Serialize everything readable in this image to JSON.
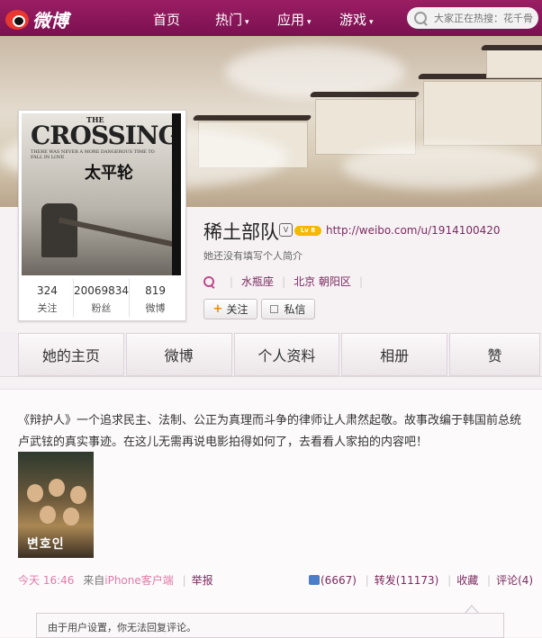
{
  "nav": {
    "brand": "微博",
    "items": [
      {
        "label": "首页",
        "caret": ""
      },
      {
        "label": "热门",
        "caret": "▾"
      },
      {
        "label": "应用",
        "caret": "▾"
      },
      {
        "label": "游戏",
        "caret": "▾"
      }
    ],
    "search_placeholder": "大家正在热搜：花千骨"
  },
  "profile": {
    "poster_title": "CROSSING",
    "poster_the": "THE",
    "poster_tagline": "THERE WAS NEVER A MORE DANGEROUS TIME TO FALL IN LOVE",
    "poster_cn": "太平轮",
    "stats": [
      {
        "value": "324",
        "label": "关注"
      },
      {
        "value": "20069834",
        "label": "粉丝"
      },
      {
        "value": "819",
        "label": "微博"
      }
    ],
    "name": "稀土部队",
    "vip_badge": "V",
    "level_badge": "Lv 8",
    "url": "http://weibo.com/u/1914100420",
    "bio": "她还没有填写个人简介",
    "zodiac": "水瓶座",
    "location": "北京 朝阳区",
    "follow_label": "关注",
    "message_label": "私信"
  },
  "tabs": [
    "她的主页",
    "微博",
    "个人资料",
    "相册",
    "赞"
  ],
  "post": {
    "text": "《辩护人》一个追求民主、法制、公正为真理而斗争的律师让人肃然起敬。故事改编于韩国前总统卢武铉的真实事迹。在这儿无需再说电影拍得如何了，去看看人家拍的内容吧！",
    "image_caption": "변호인",
    "time": "今天 16:46",
    "source_prefix": "来自",
    "source": "iPhone客户端",
    "report": "举报",
    "likes": "(6667)",
    "repost": "转发(11173)",
    "favorite": "收藏",
    "comment": "评论(4)",
    "comment_notice": "由于用户设置，你无法回复评论。"
  },
  "colors": {
    "nav_bg": "#8a1858",
    "link": "#7b2a5f",
    "accent": "#f08a00"
  }
}
